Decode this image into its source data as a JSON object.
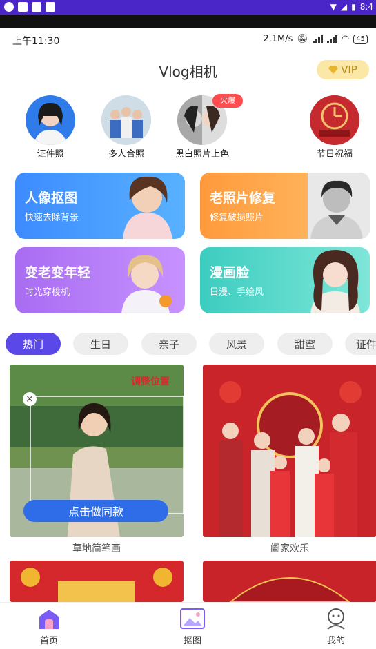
{
  "system_bar": {
    "time": "8:4"
  },
  "status_bar": {
    "time": "上午11:30",
    "speed": "2.1M/s",
    "battery": "45"
  },
  "header": {
    "title": "Vlog相机",
    "vip_label": "VIP"
  },
  "circle_features": [
    {
      "label": "证件照"
    },
    {
      "label": "多人合照"
    },
    {
      "label": "黑白照片上色",
      "badge": "火爆"
    },
    {
      "label": "节日祝福"
    }
  ],
  "feature_cards": [
    {
      "title": "人像抠图",
      "subtitle": "快速去除背景",
      "color_from": "#3d8bff",
      "color_to": "#58b2ff"
    },
    {
      "title": "老照片修复",
      "subtitle": "修复破损照片",
      "color_from": "#ff9a3c",
      "color_to": "#ffc06b"
    },
    {
      "title": "变老变年轻",
      "subtitle": "时光穿梭机",
      "color_from": "#a86cf2",
      "color_to": "#c792ff"
    },
    {
      "title": "漫画脸",
      "subtitle": "日漫、手绘风",
      "color_from": "#3ccdc0",
      "color_to": "#7fe6d8"
    }
  ],
  "tabs": [
    {
      "label": "热门",
      "active": true
    },
    {
      "label": "生日"
    },
    {
      "label": "亲子"
    },
    {
      "label": "风景"
    },
    {
      "label": "甜蜜"
    },
    {
      "label": "证件"
    }
  ],
  "templates": [
    {
      "caption": "草地简笔画",
      "overlay_tag": "调整位置",
      "action_button": "点击做同款"
    },
    {
      "caption": "阖家欢乐"
    }
  ],
  "bottom_nav": [
    {
      "label": "首页",
      "active": true
    },
    {
      "label": "抠图"
    },
    {
      "label": "我的"
    }
  ],
  "colors": {
    "accent": "#5a48e8",
    "system_bar": "#4a26c9",
    "vip_bg": "#fbe8a7"
  }
}
